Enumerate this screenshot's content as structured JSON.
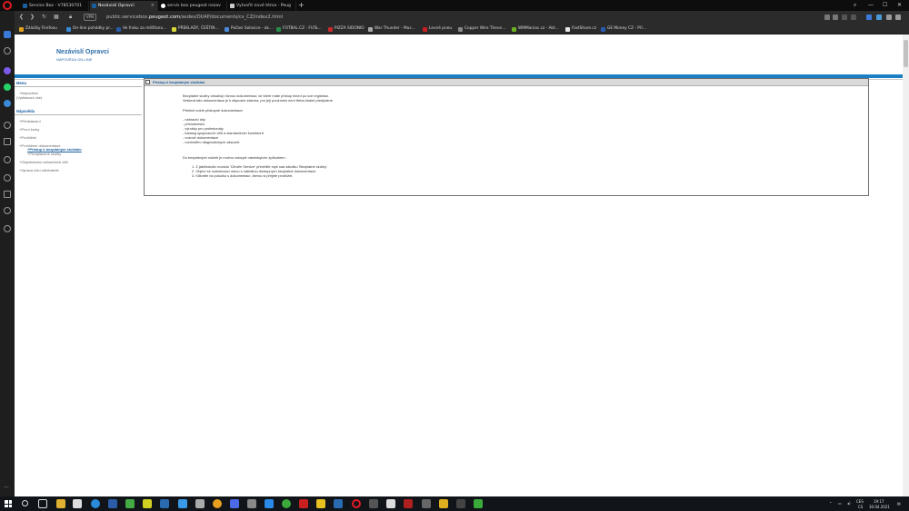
{
  "browser": {
    "tabs": [
      {
        "label": "Service Box - V78530701",
        "active": false,
        "favicon_color": "#1a5e9c"
      },
      {
        "label": "Nezávislí Opravci",
        "active": true,
        "favicon_color": "#1a5e9c"
      },
      {
        "label": "servis box peugeot nezav",
        "active": false,
        "favicon_color": "#ffffff"
      },
      {
        "label": "Vytvořit nové téma - Peug",
        "active": false,
        "favicon_color": "#cccccc"
      }
    ],
    "new_tab_label": "+",
    "url_prefix": "public.servicebox.",
    "url_domain": "peugeot.com",
    "url_path": "/asdes/OI/AP/documents/cs_CZ/index2.html",
    "vpn_label": "VPN",
    "bookmarks": [
      {
        "label": "Záložky Firefoxu",
        "color": "#e0a020"
      },
      {
        "label": "On-line pohádky pr...",
        "color": "#3a8ad8"
      },
      {
        "label": "Ve fraku za měšťana...",
        "color": "#2b5ca8"
      },
      {
        "label": "PŘEKLADY, ČEŠTIN...",
        "color": "#d8d838"
      },
      {
        "label": "Počasí Solosice - ak...",
        "color": "#4a8ad8"
      },
      {
        "label": "FOTBAL.CZ - FUTa...",
        "color": "#2a8a4a"
      },
      {
        "label": "PIZZA SIDONIO",
        "color": "#c82a2a"
      },
      {
        "label": "War Thunder - Mus...",
        "color": "#aaaaaa"
      },
      {
        "label": "Levné pneu",
        "color": "#c82020"
      },
      {
        "label": "Copper Wire Theve...",
        "color": "#888888"
      },
      {
        "label": "WMManiac.cz - Akt...",
        "color": "#6ab020"
      },
      {
        "label": "FastShare.cz",
        "color": "#e8e8e8"
      },
      {
        "label": "GE Money CZ - Při...",
        "color": "#2a5ab0"
      }
    ]
  },
  "site": {
    "title": "Nezávislí Opravci",
    "subtitle": "NÁPOVĚDA ON-LINE"
  },
  "nav": {
    "menu_heading": "Menu",
    "menu_items": [
      "Nápověda",
      "(Vytisknout vše)"
    ],
    "help_heading": "Nápověda",
    "help_items": [
      "Představení",
      "První kroky",
      "Prohlížeč",
      "Prohlížení dokumentace",
      "Přístup k bezplatným službám",
      "Předplacené služby",
      "Objednávání náhradních dílů",
      "Správa účtu odběratele"
    ]
  },
  "panel": {
    "toggle": "-",
    "title": "Přístup k bezplatným službám",
    "intro_1": "Bezplatné služby obsahují různou dokumentaci, ke které máte přístup ihned po své registraci.",
    "intro_2": "Veškerá tato dokumentace je k dispozici zdarma, pro její používání není třeba žádné předplatné.",
    "overview_heading": "Přehled volně přístupné dokumentace:",
    "overview_items": [
      "- náhradní díly",
      "- příslušenství",
      "- výrobky pro profesionály",
      "- katalog spojovacích dílů a standardních konektorů",
      "- vozové dokumentace",
      "- rozmístění diagnostických zásuvek"
    ],
    "access_heading": "Do bezplatných služeb je možno vstoupit následujícím způsobem :",
    "steps": [
      "1. Z jakéhokoliv modulu 'Citroën Service' převěďte myš nad záložku 'Bezplatné služby'.",
      "2. Objeví se rozbalovací menu s nabídkou dostupných bezplatné dokumentace.",
      "3. Klikněte na položku s dokumentací, kterou si přejete prohlížet."
    ]
  },
  "taskbar": {
    "language_top": "CES",
    "language_bottom": "CS",
    "time": "19:17",
    "date": "30.04.2021"
  }
}
